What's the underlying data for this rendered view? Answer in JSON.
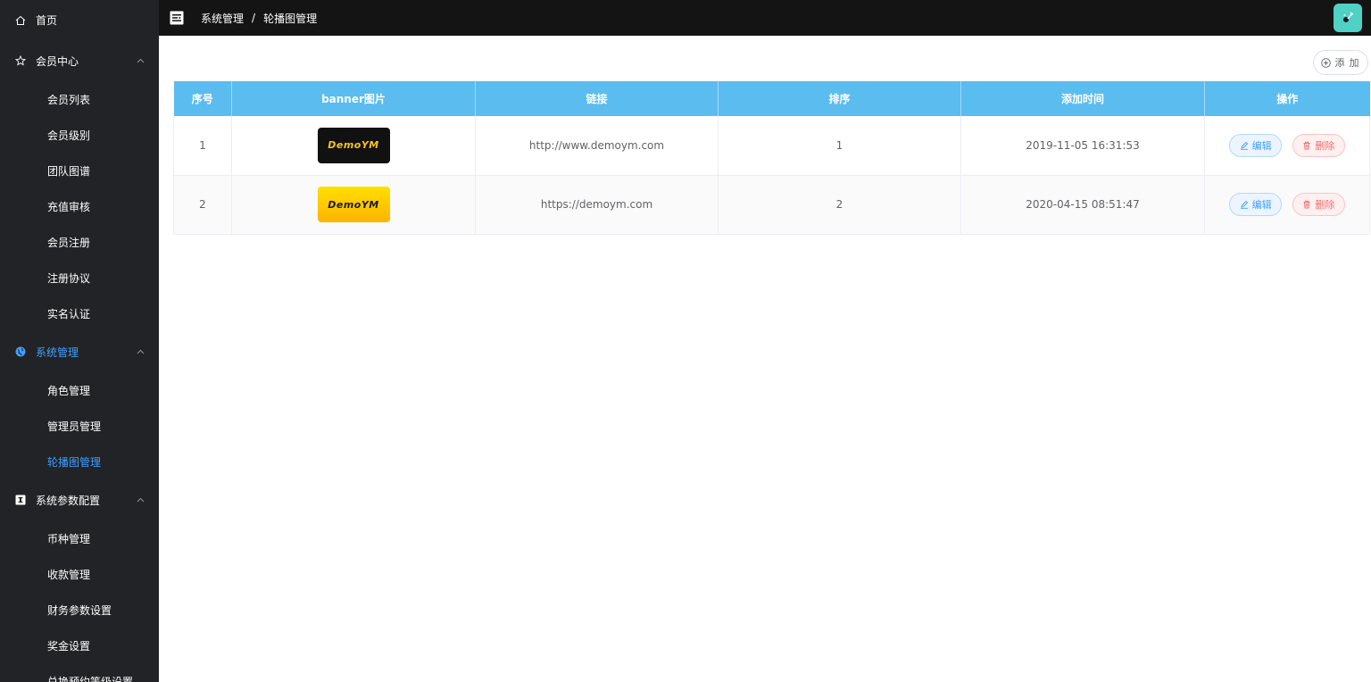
{
  "sidebar": {
    "home": "首页",
    "member_center": {
      "label": "会员中心",
      "items": [
        "会员列表",
        "会员级别",
        "团队图谱",
        "充值审核",
        "会员注册",
        "注册协议",
        "实名认证"
      ]
    },
    "system_management": {
      "label": "系统管理",
      "items": [
        "角色管理",
        "管理员管理",
        "轮播图管理"
      ]
    },
    "system_params": {
      "label": "系统参数配置",
      "items": [
        "币种管理",
        "收款管理",
        "财务参数设置",
        "奖金设置",
        "兑换预约等级设置"
      ]
    }
  },
  "header": {
    "breadcrumb": [
      "系统管理",
      "轮播图管理"
    ],
    "separator": "/"
  },
  "toolbar": {
    "add_label": "添 加"
  },
  "table": {
    "columns": [
      "序号",
      "banner图片",
      "链接",
      "排序",
      "添加时间",
      "操作"
    ],
    "rows": [
      {
        "index": "1",
        "banner_text": "DemoYM",
        "link": "http://www.demoym.com",
        "sort": "1",
        "time": "2019-11-05 16:31:53"
      },
      {
        "index": "2",
        "banner_text": "DemoYM",
        "link": "https://demoym.com",
        "sort": "2",
        "time": "2020-04-15 08:51:47"
      }
    ],
    "edit_label": "编辑",
    "delete_label": "删除"
  },
  "colors": {
    "sidebar_bg": "#222326",
    "header_bg": "#141414",
    "active": "#409eff",
    "table_header": "#5bbcef",
    "avatar_bg": "#4fd1c5"
  }
}
